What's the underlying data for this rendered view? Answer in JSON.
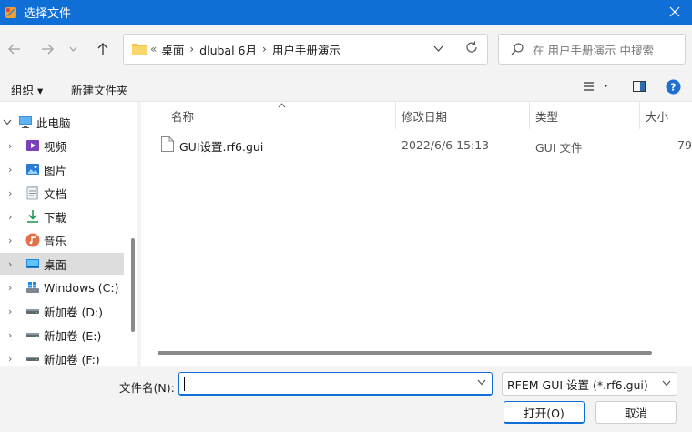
{
  "window": {
    "title": "选择文件"
  },
  "address": {
    "overflow": "«",
    "crumbs": [
      "桌面",
      "dlubal 6月",
      "用户手册演示"
    ]
  },
  "search": {
    "placeholder": "在 用户手册演示 中搜索"
  },
  "commands": {
    "organize": "组织 ▾",
    "new_folder": "新建文件夹"
  },
  "nav": {
    "items": [
      {
        "label": "此电脑",
        "icon": "pc-icon"
      },
      {
        "label": "视频",
        "icon": "video-icon"
      },
      {
        "label": "图片",
        "icon": "pictures-icon"
      },
      {
        "label": "文档",
        "icon": "documents-icon"
      },
      {
        "label": "下载",
        "icon": "download-icon"
      },
      {
        "label": "音乐",
        "icon": "music-icon"
      },
      {
        "label": "桌面",
        "icon": "desktop-icon"
      },
      {
        "label": "Windows (C:)",
        "icon": "windows-drive-icon"
      },
      {
        "label": "新加卷 (D:)",
        "icon": "drive-icon"
      },
      {
        "label": "新加卷 (E:)",
        "icon": "drive-icon"
      },
      {
        "label": "新加卷 (F:)",
        "icon": "drive-icon"
      }
    ]
  },
  "columns": {
    "name": "名称",
    "date": "修改日期",
    "type": "类型",
    "size": "大小"
  },
  "files": [
    {
      "name": "GUI设置.rf6.gui",
      "date": "2022/6/6 15:13",
      "type": "GUI 文件",
      "size": "79"
    }
  ],
  "bottom": {
    "filename_label": "文件名(N):",
    "filename_value": "",
    "filter": "RFEM GUI 设置 (*.rf6.gui)",
    "open": "打开(O)",
    "cancel": "取消"
  },
  "colors": {
    "accent": "#0f6fd6",
    "selected_nav": "#dddddd"
  }
}
